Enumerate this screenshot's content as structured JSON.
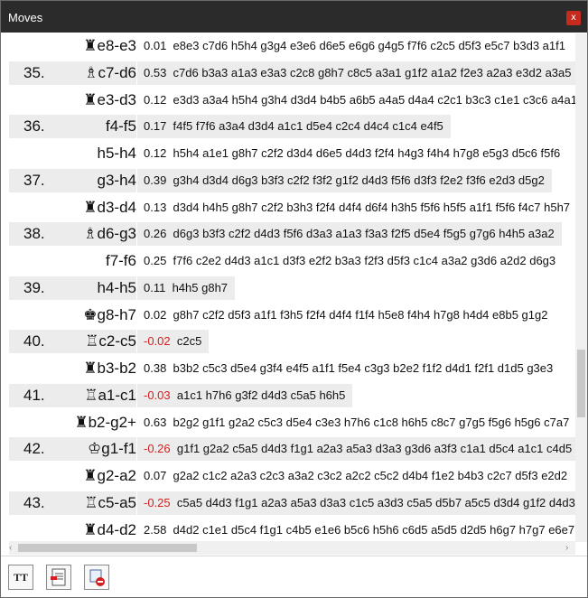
{
  "window": {
    "title": "Moves",
    "close_glyph": "x"
  },
  "rows": [
    {
      "num": "",
      "piece": "♜",
      "move": "e8-e3",
      "score": "0.01",
      "line": "e8e3 c7d6 h5h4 g3g4 e3e6 d6e5 e6g6 g4g5 f7f6 c2c5 d5f3 e5c7 b3d3 a1f1"
    },
    {
      "num": "35.",
      "piece": "♗",
      "move": "c7-d6",
      "score": "0.53",
      "line": "c7d6 b3a3 a1a3 e3a3 c2c8 g8h7 c8c5 a3a1 g1f2 a1a2 f2e3 a2a3 e3d2 a3a5"
    },
    {
      "num": "",
      "piece": "♜",
      "move": "e3-d3",
      "score": "0.12",
      "line": "e3d3 a3a4 h5h4 g3h4 d3d4 b4b5 a6b5 a4a5 d4a4 c2c1 b3c3 c1e1 c3c6 a4a1"
    },
    {
      "num": "36.",
      "piece": "",
      "move": "f4-f5",
      "score": "0.17",
      "line": "f4f5 f7f6 a3a4 d3d4 a1c1 d5e4 c2c4 d4c4 c1c4 e4f5"
    },
    {
      "num": "",
      "piece": "",
      "move": "h5-h4",
      "score": "0.12",
      "line": "h5h4 a1e1 g8h7 c2f2 d3d4 d6e5 d4d3 f2f4 h4g3 f4h4 h7g8 e5g3 d5c6 f5f6"
    },
    {
      "num": "37.",
      "piece": "",
      "move": "g3-h4",
      "score": "0.39",
      "line": "g3h4 d3d4 d6g3 b3f3 c2f2 f3f2 g1f2 d4d3 f5f6 d3f3 f2e2 f3f6 e2d3 d5g2"
    },
    {
      "num": "",
      "piece": "♜",
      "move": "d3-d4",
      "score": "0.13",
      "line": "d3d4 h4h5 g8h7 c2f2 b3h3 f2f4 d4f4 d6f4 h3h5 f5f6 h5f5 a1f1 f5f6 f4c7 h5h7"
    },
    {
      "num": "38.",
      "piece": "♗",
      "move": "d6-g3",
      "score": "0.26",
      "line": "d6g3 b3f3 c2f2 d4d3 f5f6 d3a3 a1a3 f3a3 f2f5 d5e4 f5g5 g7g6 h4h5 a3a2"
    },
    {
      "num": "",
      "piece": "",
      "move": "f7-f6",
      "score": "0.25",
      "line": "f7f6 c2e2 d4d3 a1c1 d3f3 e2f2 b3a3 f2f3 d5f3 c1c4 a3a2 g3d6 a2d2 d6g3"
    },
    {
      "num": "39.",
      "piece": "",
      "move": "h4-h5",
      "score": "0.11",
      "line": "h4h5 g8h7"
    },
    {
      "num": "",
      "piece": "♚",
      "move": "g8-h7",
      "score": "0.02",
      "line": "g8h7 c2f2 d5f3 a1f1 f3h5 f2f4 d4f4 f1f4 h5e8 f4h4 h7g8 h4d4 e8b5 g1g2"
    },
    {
      "num": "40.",
      "piece": "♖",
      "move": "c2-c5",
      "score": "-0.02",
      "line": "c2c5"
    },
    {
      "num": "",
      "piece": "♜",
      "move": "b3-b2",
      "score": "0.38",
      "line": "b3b2 c5c3 d5e4 g3f4 e4f5 a1f1 f5e4 c3g3 b2e2 f1f2 d4d1 f2f1 d1d5 g3e3"
    },
    {
      "num": "41.",
      "piece": "♖",
      "move": "a1-c1",
      "score": "-0.03",
      "line": "a1c1 h7h6 g3f2 d4d3 c5a5 h6h5"
    },
    {
      "num": "",
      "piece": "♜",
      "move": "b2-g2+",
      "score": "0.63",
      "line": "b2g2 g1f1 g2a2 c5c3 d5e4 c3e3 h7h6 c1c8 h6h5 c8c7 g7g5 f5g6 h5g6 c7a7"
    },
    {
      "num": "42.",
      "piece": "♔",
      "move": "g1-f1",
      "score": "-0.26",
      "line": "g1f1 g2a2 c5a5 d4d3 f1g1 a2a3 a5a3 d3a3 g3d6 a3f3 c1a1 d5c4 a1c1 c4d5"
    },
    {
      "num": "",
      "piece": "♜",
      "move": "g2-a2",
      "score": "0.07",
      "line": "g2a2 c1c2 a2a3 c2c3 a3a2 c3c2 a2c2 c5c2 d4b4 f1e2 b4b3 c2c7 d5f3 e2d2"
    },
    {
      "num": "43.",
      "piece": "♖",
      "move": "c5-a5",
      "score": "-0.25",
      "line": "c5a5 d4d3 f1g1 a2a3 a5a3 d3a3 c1c5 a3d3 c5a5 d5b7 a5c5 d3d4 g1f2 d4d3"
    },
    {
      "num": "",
      "piece": "♜",
      "move": "d4-d2",
      "score": "2.58",
      "line": "d4d2 c1e1 d5c4 f1g1 c4b5 e1e6 b5c6 h5h6 c6d5 a5d5 d2d5 h6g7 h7g7 e6e7"
    }
  ],
  "toolbar": {
    "font_label": "TT"
  }
}
